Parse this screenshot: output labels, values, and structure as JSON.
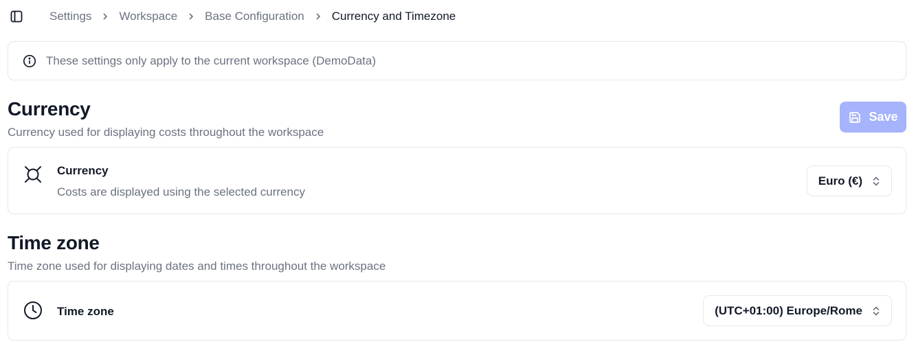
{
  "breadcrumb": [
    "Settings",
    "Workspace",
    "Base Configuration",
    "Currency and Timezone"
  ],
  "info_banner": {
    "text": "These settings only apply to the current workspace (DemoData)"
  },
  "currency_section": {
    "title": "Currency",
    "description": "Currency used for displaying costs throughout the workspace",
    "save_label": "Save",
    "setting": {
      "label": "Currency",
      "sublabel": "Costs are displayed using the selected currency",
      "value": "Euro (€)",
      "icon": "currency-icon"
    }
  },
  "timezone_section": {
    "title": "Time zone",
    "description": "Time zone used for displaying dates and times throughout the workspace",
    "setting": {
      "label": "Time zone",
      "value": "(UTC+01:00) Europe/Rome",
      "icon": "clock-icon"
    }
  },
  "colors": {
    "save_button_disabled": "#a5b4fc",
    "muted_text": "#6b7280",
    "border": "#e5e7eb"
  }
}
